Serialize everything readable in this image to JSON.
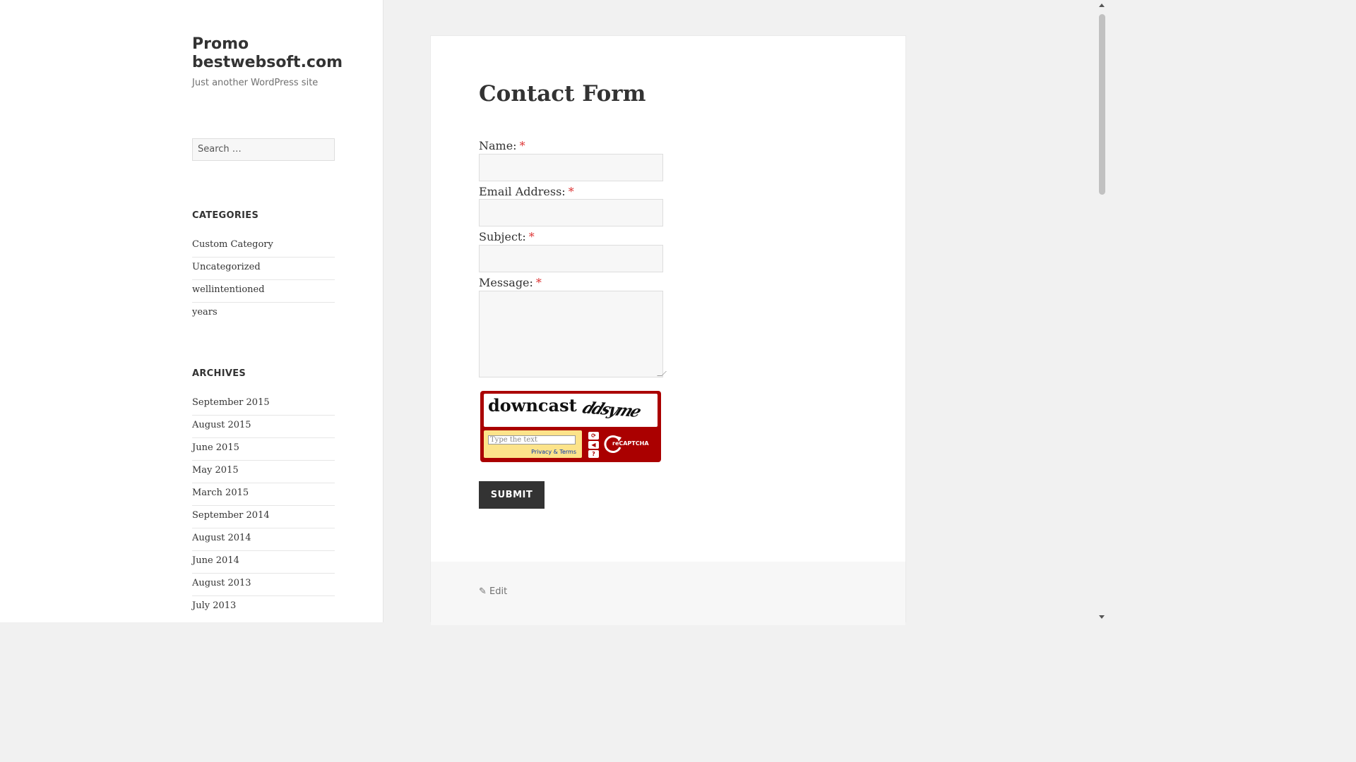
{
  "site": {
    "title": "Promo bestwebsoft.com",
    "tagline": "Just another WordPress site"
  },
  "search": {
    "placeholder": "Search …"
  },
  "categories": {
    "heading": "CATEGORIES",
    "items": [
      "Custom Category",
      "Uncategorized",
      "wellintentioned",
      "years"
    ]
  },
  "archives": {
    "heading": "ARCHIVES",
    "items": [
      "September 2015",
      "August 2015",
      "June 2015",
      "May 2015",
      "March 2015",
      "September 2014",
      "August 2014",
      "June 2014",
      "August 2013",
      "July 2013"
    ]
  },
  "article": {
    "title": "Contact Form",
    "fields": {
      "name_label": "Name:",
      "email_label": "Email Address:",
      "subject_label": "Subject:",
      "message_label": "Message:",
      "required_marker": "*"
    },
    "captcha": {
      "word1": "downcast",
      "word2": "ddsyme",
      "input_placeholder": "Type the text",
      "terms_link": "Privacy & Terms",
      "refresh_icon": "refresh-icon",
      "audio_icon": "audio-icon",
      "help_icon": "help-icon",
      "brand": "reCAPTCHA"
    },
    "submit_label": "SUBMIT",
    "edit_label": "Edit"
  },
  "colors": {
    "required": "#dd3333",
    "captcha_bg": "#aa0000",
    "captcha_input_bg": "#fce38a",
    "submit_bg": "#333333"
  }
}
